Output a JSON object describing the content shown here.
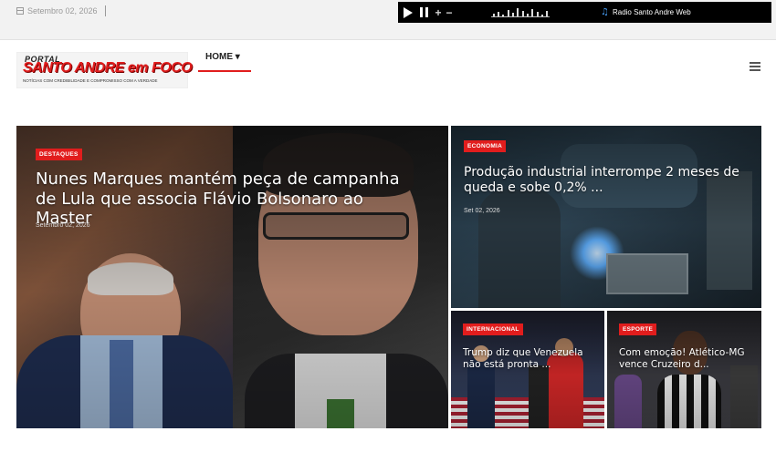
{
  "topbar": {
    "date": "Setembro 02, 2026",
    "radio": {
      "volume_up": "+",
      "volume_down": "−",
      "station": "Radio Santo Andre Web"
    }
  },
  "header": {
    "logo": {
      "portal": "PORTAL",
      "name": "SANTO ANDRE em FOCO",
      "tagline": "NOTÍCIAS COM CREDIBILIDADE E COMPROMISSO COM A VERDADE"
    },
    "nav": {
      "home": "HOME ▾"
    }
  },
  "featured": {
    "category": "DESTAQUES",
    "title": "Nunes Marques mantém peça de campanha de Lula que associa Flávio Bolsonaro ao Master",
    "date": "Setembro 02, 2026"
  },
  "top_right": {
    "category": "ECONOMIA",
    "title": "Produção industrial interrompe 2 meses de queda e sobe 0,2% ...",
    "date": "Set 02, 2026"
  },
  "bottom_left": {
    "category": "INTERNACIONAL",
    "title": "Trump diz que Venezuela não está pronta ..."
  },
  "bottom_right": {
    "category": "ESPORTE",
    "title": "Com emoção! Atlético-MG vence Cruzeiro d..."
  },
  "icons": [
    "calendar-icon",
    "play-icon",
    "pause-icon",
    "music-note-icon",
    "hamburger-icon"
  ],
  "colors": {
    "accent": "#e11d1d",
    "radio_bg": "#000000",
    "topbar_bg": "#f2f2f2"
  }
}
